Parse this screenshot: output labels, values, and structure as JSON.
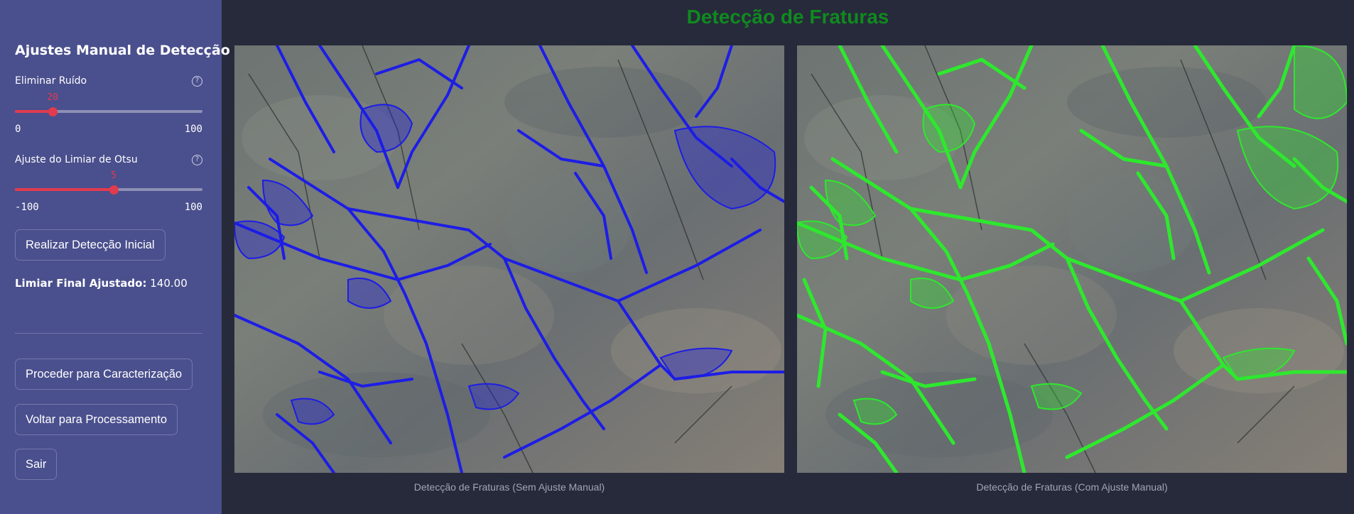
{
  "sidebar": {
    "title": "Ajustes Manual de Detecção",
    "noise_slider": {
      "label": "Eliminar Ruído",
      "value": "20",
      "min": "0",
      "max": "100",
      "fraction": 0.2
    },
    "otsu_slider": {
      "label": "Ajuste do Limiar de Otsu",
      "value": "5",
      "min": "-100",
      "max": "100",
      "fraction": 0.525
    },
    "initial_detection_button": "Realizar Detecção Inicial",
    "final_threshold_label": "Limiar Final Ajustado:",
    "final_threshold_value": "140.00",
    "proceed_button": "Proceder para Caracterização",
    "back_button": "Voltar para Processamento",
    "exit_button": "Sair",
    "help_icon": "question-circle-icon"
  },
  "main": {
    "title": "Detecção de Fraturas",
    "left_image_caption": "Detecção de Fraturas (Sem Ajuste Manual)",
    "right_image_caption": "Detecção de Fraturas (Com Ajuste Manual)"
  },
  "colors": {
    "sidebar_bg": "#4a4f8d",
    "main_bg": "#272a3a",
    "accent": "#e23b4e",
    "title_green": "#0f8a1f",
    "overlay_blue": "#1a1ae0",
    "overlay_green": "#2ee82e"
  }
}
